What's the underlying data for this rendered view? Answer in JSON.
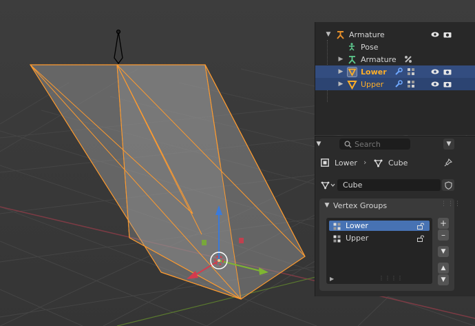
{
  "outliner": {
    "rows": [
      {
        "label": "Armature",
        "color": "#d6d6d6"
      },
      {
        "label": "Pose",
        "color": "#d6d6d6"
      },
      {
        "label": "Armature",
        "color": "#d6d6d6"
      },
      {
        "label": "Lower",
        "color": "#ffaf29"
      },
      {
        "label": "Upper",
        "color": "#ffaf29"
      }
    ]
  },
  "properties": {
    "search_placeholder": "Search",
    "breadcrumb": {
      "object": "Lower",
      "data": "Cube"
    },
    "mesh_name": "Cube",
    "vertex_groups": {
      "title": "Vertex Groups",
      "items": [
        "Lower",
        "Upper"
      ],
      "active_index": 0
    }
  },
  "colors": {
    "selection": "#334d80",
    "active_item": "#4772b3",
    "object_orange": "#ffaf29",
    "armature_green": "#5ecc8f"
  }
}
